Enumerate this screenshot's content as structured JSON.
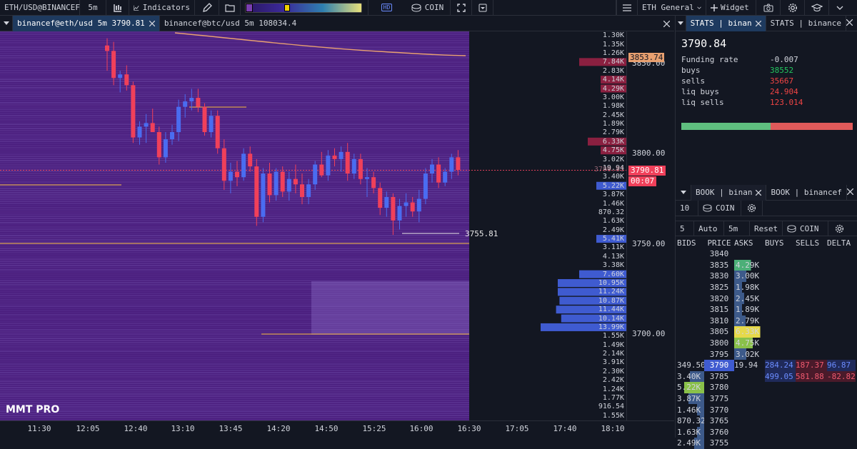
{
  "toolbar": {
    "symbol": "ETH/USD@BINANCEF",
    "interval": "5m",
    "indicators_label": "Indicators",
    "hd_label": "HD",
    "coin_label": "COIN",
    "layout_label": "ETH General",
    "widget_label": "Widget"
  },
  "tabs": [
    {
      "label": "binancef@eth/usd 5m 3790.81"
    },
    {
      "label": "binancef@btc/usd 5m 108034.4"
    }
  ],
  "brand": "MMT PRO",
  "chart_data": {
    "type": "candlestick-heatmap",
    "y_axis_labels": [
      "3850.00",
      "3800.00",
      "3750.00",
      "3700.00"
    ],
    "x_axis_labels": [
      "11:30",
      "12:05",
      "12:40",
      "13:10",
      "13:45",
      "14:20",
      "14:50",
      "15:25",
      "16:00",
      "16:30",
      "17:05",
      "17:40",
      "18:10"
    ],
    "last_price": "3790.81",
    "countdown": "00:07",
    "vwap_label": "3853.74",
    "low_marker": "3755.81",
    "stacked_price": "3790.81",
    "volume_profile": [
      {
        "label": "1.30K",
        "side": "none"
      },
      {
        "label": "1.35K",
        "side": "none"
      },
      {
        "label": "1.26K",
        "side": "none"
      },
      {
        "label": "7.84K",
        "side": "ask",
        "rel": 0.55
      },
      {
        "label": "2.83K",
        "side": "none"
      },
      {
        "label": "4.14K",
        "side": "ask",
        "rel": 0.3
      },
      {
        "label": "4.29K",
        "side": "ask",
        "rel": 0.3
      },
      {
        "label": "3.00K",
        "side": "none"
      },
      {
        "label": "1.98K",
        "side": "none"
      },
      {
        "label": "2.45K",
        "side": "none"
      },
      {
        "label": "1.89K",
        "side": "none"
      },
      {
        "label": "2.79K",
        "side": "none"
      },
      {
        "label": "6.33K",
        "side": "ask",
        "rel": 0.45
      },
      {
        "label": "4.75K",
        "side": "ask",
        "rel": 0.3
      },
      {
        "label": "3.02K",
        "side": "none"
      },
      {
        "label": "19.94",
        "side": "none"
      },
      {
        "label": "3.40K",
        "side": "none"
      },
      {
        "label": "5.22K",
        "side": "bid",
        "rel": 0.35
      },
      {
        "label": "3.87K",
        "side": "none"
      },
      {
        "label": "1.46K",
        "side": "none"
      },
      {
        "label": "870.32",
        "side": "none"
      },
      {
        "label": "1.63K",
        "side": "none"
      },
      {
        "label": "2.49K",
        "side": "none"
      },
      {
        "label": "5.41K",
        "side": "bid",
        "rel": 0.35
      },
      {
        "label": "3.11K",
        "side": "none"
      },
      {
        "label": "4.13K",
        "side": "none"
      },
      {
        "label": "3.38K",
        "side": "none"
      },
      {
        "label": "7.60K",
        "side": "bid",
        "rel": 0.55
      },
      {
        "label": "10.95K",
        "side": "bid",
        "rel": 0.8
      },
      {
        "label": "11.24K",
        "side": "bid",
        "rel": 0.8
      },
      {
        "label": "10.87K",
        "side": "bid",
        "rel": 0.78
      },
      {
        "label": "11.44K",
        "side": "bid",
        "rel": 0.82
      },
      {
        "label": "10.14K",
        "side": "bid",
        "rel": 0.76
      },
      {
        "label": "13.99K",
        "side": "bid",
        "rel": 1.0
      },
      {
        "label": "1.55K",
        "side": "none"
      },
      {
        "label": "1.49K",
        "side": "none"
      },
      {
        "label": "2.14K",
        "side": "none"
      },
      {
        "label": "3.91K",
        "side": "none"
      },
      {
        "label": "2.30K",
        "side": "none"
      },
      {
        "label": "2.42K",
        "side": "none"
      },
      {
        "label": "1.24K",
        "side": "none"
      },
      {
        "label": "1.77K",
        "side": "none"
      },
      {
        "label": "916.54",
        "side": "none"
      },
      {
        "label": "1.55K",
        "side": "none"
      }
    ],
    "candles": [
      {
        "o": 3860,
        "h": 3864,
        "l": 3846,
        "c": 3857
      },
      {
        "o": 3857,
        "h": 3862,
        "l": 3838,
        "c": 3842
      },
      {
        "o": 3842,
        "h": 3846,
        "l": 3834,
        "c": 3844
      },
      {
        "o": 3844,
        "h": 3849,
        "l": 3835,
        "c": 3838
      },
      {
        "o": 3838,
        "h": 3840,
        "l": 3806,
        "c": 3809
      },
      {
        "o": 3809,
        "h": 3818,
        "l": 3805,
        "c": 3815
      },
      {
        "o": 3815,
        "h": 3822,
        "l": 3806,
        "c": 3817
      },
      {
        "o": 3817,
        "h": 3825,
        "l": 3812,
        "c": 3812
      },
      {
        "o": 3812,
        "h": 3815,
        "l": 3794,
        "c": 3798
      },
      {
        "o": 3798,
        "h": 3812,
        "l": 3795,
        "c": 3808
      },
      {
        "o": 3808,
        "h": 3816,
        "l": 3805,
        "c": 3812
      },
      {
        "o": 3812,
        "h": 3830,
        "l": 3807,
        "c": 3826
      },
      {
        "o": 3826,
        "h": 3833,
        "l": 3820,
        "c": 3829
      },
      {
        "o": 3829,
        "h": 3836,
        "l": 3824,
        "c": 3831
      },
      {
        "o": 3831,
        "h": 3836,
        "l": 3823,
        "c": 3826
      },
      {
        "o": 3826,
        "h": 3828,
        "l": 3810,
        "c": 3812
      },
      {
        "o": 3812,
        "h": 3824,
        "l": 3809,
        "c": 3821
      },
      {
        "o": 3821,
        "h": 3824,
        "l": 3800,
        "c": 3803
      },
      {
        "o": 3803,
        "h": 3808,
        "l": 3780,
        "c": 3785
      },
      {
        "o": 3785,
        "h": 3795,
        "l": 3778,
        "c": 3790
      },
      {
        "o": 3790,
        "h": 3796,
        "l": 3782,
        "c": 3787
      },
      {
        "o": 3787,
        "h": 3803,
        "l": 3785,
        "c": 3800
      },
      {
        "o": 3800,
        "h": 3804,
        "l": 3790,
        "c": 3793
      },
      {
        "o": 3793,
        "h": 3797,
        "l": 3760,
        "c": 3765
      },
      {
        "o": 3765,
        "h": 3792,
        "l": 3762,
        "c": 3789
      },
      {
        "o": 3789,
        "h": 3795,
        "l": 3773,
        "c": 3777
      },
      {
        "o": 3777,
        "h": 3792,
        "l": 3774,
        "c": 3790
      },
      {
        "o": 3790,
        "h": 3793,
        "l": 3776,
        "c": 3779
      },
      {
        "o": 3779,
        "h": 3790,
        "l": 3774,
        "c": 3786
      },
      {
        "o": 3786,
        "h": 3794,
        "l": 3778,
        "c": 3783
      },
      {
        "o": 3783,
        "h": 3789,
        "l": 3772,
        "c": 3776
      },
      {
        "o": 3776,
        "h": 3786,
        "l": 3772,
        "c": 3783
      },
      {
        "o": 3783,
        "h": 3796,
        "l": 3780,
        "c": 3794
      },
      {
        "o": 3794,
        "h": 3801,
        "l": 3787,
        "c": 3788
      },
      {
        "o": 3788,
        "h": 3802,
        "l": 3785,
        "c": 3799
      },
      {
        "o": 3799,
        "h": 3803,
        "l": 3793,
        "c": 3797
      },
      {
        "o": 3797,
        "h": 3804,
        "l": 3790,
        "c": 3801
      },
      {
        "o": 3801,
        "h": 3806,
        "l": 3785,
        "c": 3789
      },
      {
        "o": 3789,
        "h": 3800,
        "l": 3786,
        "c": 3797
      },
      {
        "o": 3797,
        "h": 3800,
        "l": 3783,
        "c": 3786
      },
      {
        "o": 3786,
        "h": 3792,
        "l": 3776,
        "c": 3787
      },
      {
        "o": 3787,
        "h": 3790,
        "l": 3778,
        "c": 3781
      },
      {
        "o": 3781,
        "h": 3784,
        "l": 3766,
        "c": 3770
      },
      {
        "o": 3770,
        "h": 3779,
        "l": 3765,
        "c": 3776
      },
      {
        "o": 3776,
        "h": 3778,
        "l": 3755,
        "c": 3763
      },
      {
        "o": 3763,
        "h": 3775,
        "l": 3758,
        "c": 3771
      },
      {
        "o": 3771,
        "h": 3778,
        "l": 3765,
        "c": 3773
      },
      {
        "o": 3773,
        "h": 3776,
        "l": 3765,
        "c": 3768
      },
      {
        "o": 3768,
        "h": 3780,
        "l": 3762,
        "c": 3775
      },
      {
        "o": 3775,
        "h": 3792,
        "l": 3772,
        "c": 3789
      },
      {
        "o": 3789,
        "h": 3797,
        "l": 3784,
        "c": 3794
      },
      {
        "o": 3794,
        "h": 3798,
        "l": 3781,
        "c": 3784
      },
      {
        "o": 3784,
        "h": 3792,
        "l": 3782,
        "c": 3790
      },
      {
        "o": 3790,
        "h": 3800,
        "l": 3786,
        "c": 3798
      },
      {
        "o": 3798,
        "h": 3802,
        "l": 3788,
        "c": 3791
      }
    ]
  },
  "stats": {
    "tab1": "STATS | binan",
    "tab2": "STATS | binance",
    "price": "3790.84",
    "rows": [
      {
        "k": "Funding rate",
        "v": "-0.007",
        "color": "#d1d4dc"
      },
      {
        "k": "buys",
        "v": "38552",
        "color": "#22c55e"
      },
      {
        "k": "sells",
        "v": "35667",
        "color": "#ef4444"
      },
      {
        "k": "liq buys",
        "v": "24.904",
        "color": "#ef4444"
      },
      {
        "k": "liq sells",
        "v": "123.014",
        "color": "#ef4444"
      }
    ],
    "buy_ratio": 0.52
  },
  "book": {
    "tab1": "BOOK | binan",
    "tab2": "BOOK | binancef",
    "depth": "10",
    "coin_label": "COIN",
    "interval": "5",
    "auto": "Auto",
    "tf": "5m",
    "reset": "Reset",
    "coin2": "COIN",
    "headers": [
      "BIDS",
      "PRICE",
      "ASKS",
      "BUYS",
      "SELLS",
      "DELTA"
    ],
    "rows": [
      {
        "bid": "",
        "price": "3840",
        "ask": "",
        "buy": "",
        "sell": "",
        "delta": "",
        "askrel": 0,
        "bidrel": 0
      },
      {
        "bid": "",
        "price": "3835",
        "ask": "4.29K",
        "buy": "",
        "sell": "",
        "delta": "",
        "askrel": 0.55,
        "bidrel": 0,
        "askcol": "#4caf78"
      },
      {
        "bid": "",
        "price": "3830",
        "ask": "3.00K",
        "buy": "",
        "sell": "",
        "delta": "",
        "askrel": 0.4,
        "bidrel": 0
      },
      {
        "bid": "",
        "price": "3825",
        "ask": "1.98K",
        "buy": "",
        "sell": "",
        "delta": "",
        "askrel": 0.25,
        "bidrel": 0
      },
      {
        "bid": "",
        "price": "3820",
        "ask": "2.45K",
        "buy": "",
        "sell": "",
        "delta": "",
        "askrel": 0.32,
        "bidrel": 0
      },
      {
        "bid": "",
        "price": "3815",
        "ask": "1.89K",
        "buy": "",
        "sell": "",
        "delta": "",
        "askrel": 0.25,
        "bidrel": 0
      },
      {
        "bid": "",
        "price": "3810",
        "ask": "2.79K",
        "buy": "",
        "sell": "",
        "delta": "",
        "askrel": 0.37,
        "bidrel": 0
      },
      {
        "bid": "",
        "price": "3805",
        "ask": "6.33K",
        "buy": "",
        "sell": "",
        "delta": "",
        "askrel": 0.85,
        "bidrel": 0,
        "askcol": "#e6d94a"
      },
      {
        "bid": "",
        "price": "3800",
        "ask": "4.75K",
        "buy": "",
        "sell": "",
        "delta": "",
        "askrel": 0.6,
        "bidrel": 0,
        "askcol": "#8ac14a"
      },
      {
        "bid": "",
        "price": "3795",
        "ask": "3.02K",
        "buy": "",
        "sell": "",
        "delta": "",
        "askrel": 0.4,
        "bidrel": 0
      },
      {
        "bid": "349.50",
        "price": "3790",
        "ask": "19.94",
        "buy": "284.24",
        "sell": "187.37",
        "delta": "96.87",
        "askrel": 0,
        "bidrel": 0,
        "current": true
      },
      {
        "bid": "3.40K",
        "price": "3785",
        "ask": "",
        "buy": "499.05",
        "sell": "581.88",
        "delta": "-82.82",
        "askrel": 0,
        "bidrel": 0.5
      },
      {
        "bid": "5.22K",
        "price": "3780",
        "ask": "",
        "buy": "",
        "sell": "",
        "delta": "",
        "askrel": 0,
        "bidrel": 0.7,
        "bidcol": "#8ac14a"
      },
      {
        "bid": "3.87K",
        "price": "3775",
        "ask": "",
        "buy": "",
        "sell": "",
        "delta": "",
        "askrel": 0,
        "bidrel": 0.55
      },
      {
        "bid": "1.46K",
        "price": "3770",
        "ask": "",
        "buy": "",
        "sell": "",
        "delta": "",
        "askrel": 0,
        "bidrel": 0.25
      },
      {
        "bid": "870.32",
        "price": "3765",
        "ask": "",
        "buy": "",
        "sell": "",
        "delta": "",
        "askrel": 0,
        "bidrel": 0.15
      },
      {
        "bid": "1.63K",
        "price": "3760",
        "ask": "",
        "buy": "",
        "sell": "",
        "delta": "",
        "askrel": 0,
        "bidrel": 0.25
      },
      {
        "bid": "2.49K",
        "price": "3755",
        "ask": "",
        "buy": "",
        "sell": "",
        "delta": "",
        "askrel": 0,
        "bidrel": 0.35
      }
    ]
  }
}
